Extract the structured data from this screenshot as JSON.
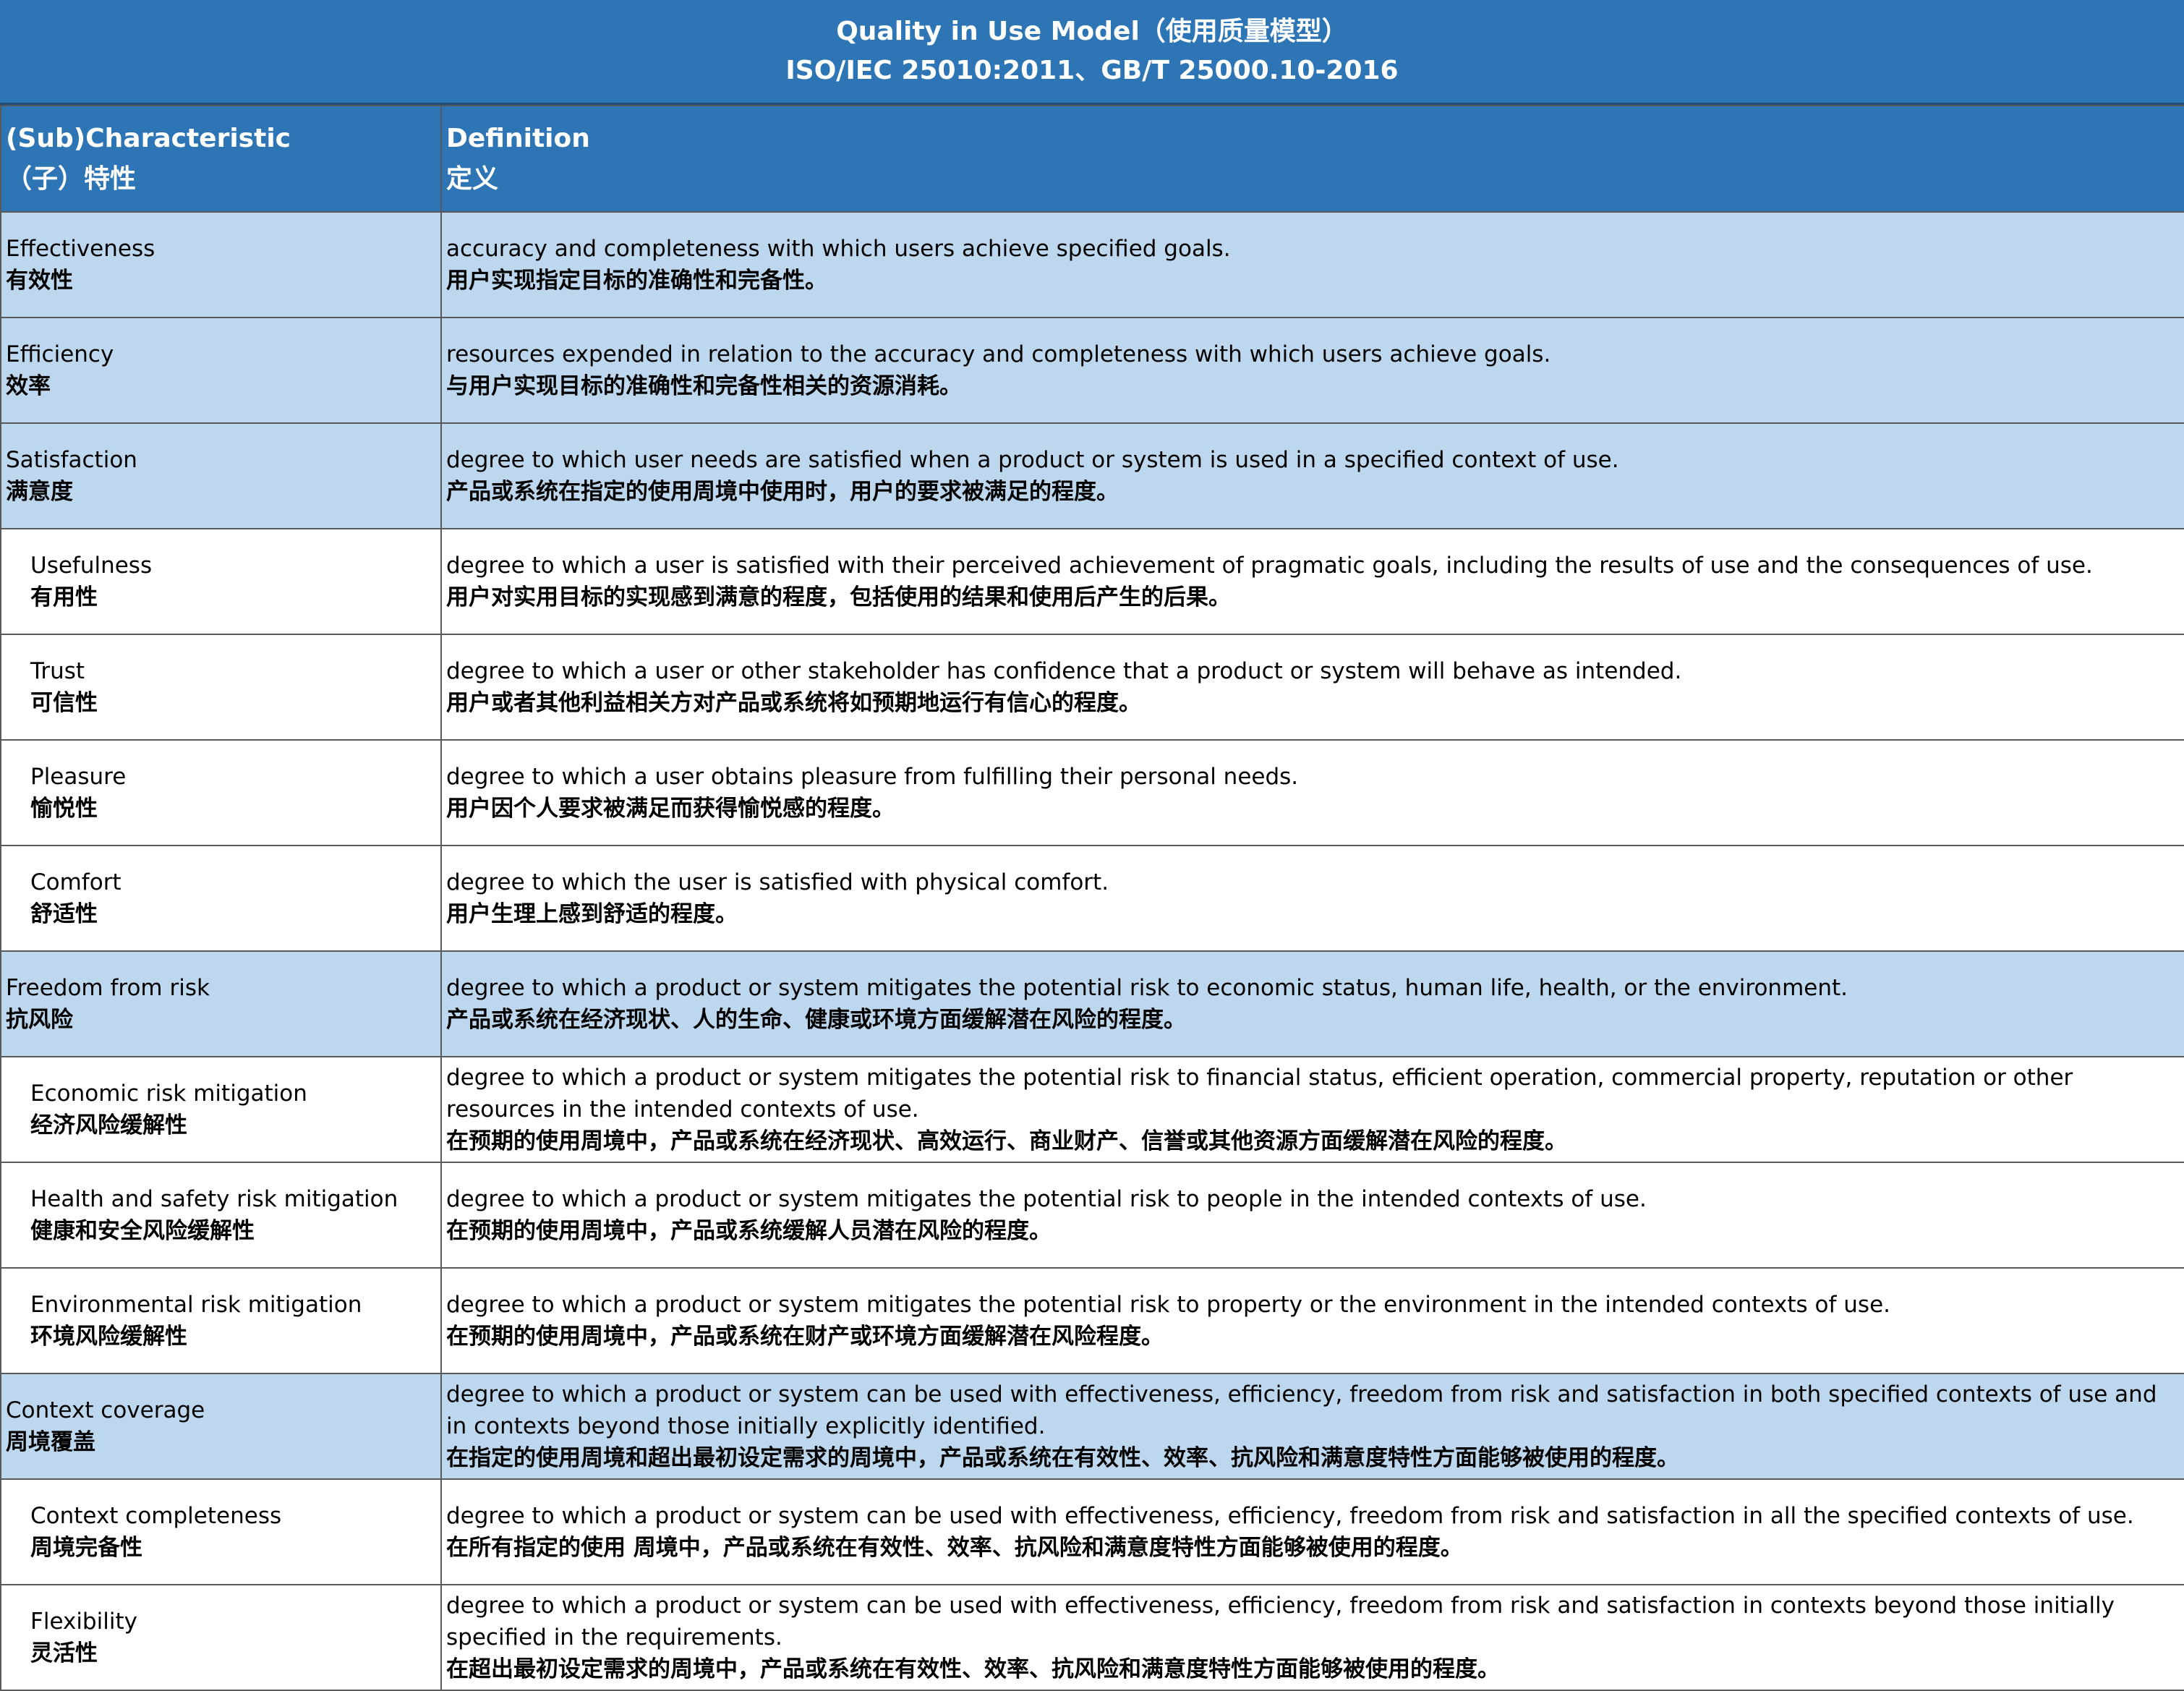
{
  "title": {
    "line1": "Quality in Use Model（使用质量模型）",
    "line2": "ISO/IEC 25010:2011、GB/T 25000.10-2016"
  },
  "header": {
    "col1_en": "(Sub)Characteristic",
    "col1_zh": "（子）特性",
    "col2_en": "Definition",
    "col2_zh": "定义"
  },
  "rows": [
    {
      "level": "main",
      "name_en": "Effectiveness",
      "name_zh": "有效性",
      "def_en": "accuracy and completeness with which users achieve specified goals.",
      "def_zh": "用户实现指定目标的准确性和完备性。"
    },
    {
      "level": "main",
      "name_en": "Efficiency",
      "name_zh": "效率",
      "def_en": "resources expended in relation to the accuracy and completeness with which users achieve goals.",
      "def_zh": "与用户实现目标的准确性和完备性相关的资源消耗。"
    },
    {
      "level": "main",
      "name_en": "Satisfaction",
      "name_zh": "满意度",
      "def_en": "degree to which user needs are satisfied when a product or system is used in a specified context of use.",
      "def_zh": "产品或系统在指定的使用周境中使用时，用户的要求被满足的程度。"
    },
    {
      "level": "sub",
      "name_en": "Usefulness",
      "name_zh": "有用性",
      "def_en": "degree to which a user is satisfied with their perceived achievement of pragmatic goals, including the results of use and the consequences of use.",
      "def_zh": "用户对实用目标的实现感到满意的程度，包括使用的结果和使用后产生的后果。"
    },
    {
      "level": "sub",
      "name_en": "Trust",
      "name_zh": "可信性",
      "def_en": "degree to which a user or other stakeholder has confidence that a product or system will behave as intended.",
      "def_zh": "用户或者其他利益相关方对产品或系统将如预期地运行有信心的程度。"
    },
    {
      "level": "sub",
      "name_en": "Pleasure",
      "name_zh": "愉悦性",
      "def_en": "degree to which a user obtains pleasure from fulfilling their personal needs.",
      "def_zh": "用户因个人要求被满足而获得愉悦感的程度。"
    },
    {
      "level": "sub",
      "name_en": "Comfort",
      "name_zh": "舒适性",
      "def_en": "degree to which the user is satisfied with physical comfort.",
      "def_zh": "用户生理上感到舒适的程度。"
    },
    {
      "level": "main",
      "name_en": "Freedom from risk",
      "name_zh": "抗风险",
      "def_en": "degree to which a product or system mitigates the potential risk to economic status, human life, health, or the environment.",
      "def_zh": "产品或系统在经济现状、人的生命、健康或环境方面缓解潜在风险的程度。"
    },
    {
      "level": "sub",
      "name_en": "Economic risk mitigation",
      "name_zh": "经济风险缓解性",
      "def_en": "degree to which a product or system mitigates the potential risk to financial status, efficient operation, commercial property, reputation or other resources in the intended contexts of use.",
      "def_zh": "在预期的使用周境中，产品或系统在经济现状、高效运行、商业财产、信誉或其他资源方面缓解潜在风险的程度。"
    },
    {
      "level": "sub",
      "name_en": "Health and safety risk mitigation",
      "name_zh": "健康和安全风险缓解性",
      "def_en": "degree to which a product or system mitigates the potential risk to people in the intended contexts of use.",
      "def_zh": "在预期的使用周境中，产品或系统缓解人员潜在风险的程度。"
    },
    {
      "level": "sub",
      "name_en": "Environmental risk mitigation",
      "name_zh": "环境风险缓解性",
      "def_en": "degree to which a product or system mitigates the potential risk to property or the environment in the intended contexts of use.",
      "def_zh": "在预期的使用周境中，产品或系统在财产或环境方面缓解潜在风险程度。"
    },
    {
      "level": "main",
      "name_en": "Context coverage",
      "name_zh": "周境覆盖",
      "def_en": "degree to which a product or system can be used with effectiveness, efficiency, freedom from risk and satisfaction in both specified contexts of use and in contexts beyond those initially explicitly identified.",
      "def_zh": "在指定的使用周境和超出最初设定需求的周境中，产品或系统在有效性、效率、抗风险和满意度特性方面能够被使用的程度。"
    },
    {
      "level": "sub",
      "name_en": "Context completeness",
      "name_zh": "周境完备性",
      "def_en": "degree to which a product or system can be used with effectiveness, efficiency, freedom from risk and satisfaction in all the specified contexts of use.",
      "def_zh": "在所有指定的使用 周境中，产品或系统在有效性、效率、抗风险和满意度特性方面能够被使用的程度。"
    },
    {
      "level": "sub",
      "name_en": "Flexibility",
      "name_zh": "灵活性",
      "def_en": "degree to which a product or system can be used with effectiveness, efficiency, freedom from risk and satisfaction in contexts beyond those initially specified in the requirements.",
      "def_zh": "在超出最初设定需求的周境中，产品或系统在有效性、效率、抗风险和满意度特性方面能够被使用的程度。"
    }
  ],
  "colors": {
    "header_bg": "#2e75b6",
    "header_text": "#ffffff",
    "main_row_bg": "#bdd7ee",
    "sub_row_bg": "#ffffff",
    "grid_line": "#595959"
  }
}
